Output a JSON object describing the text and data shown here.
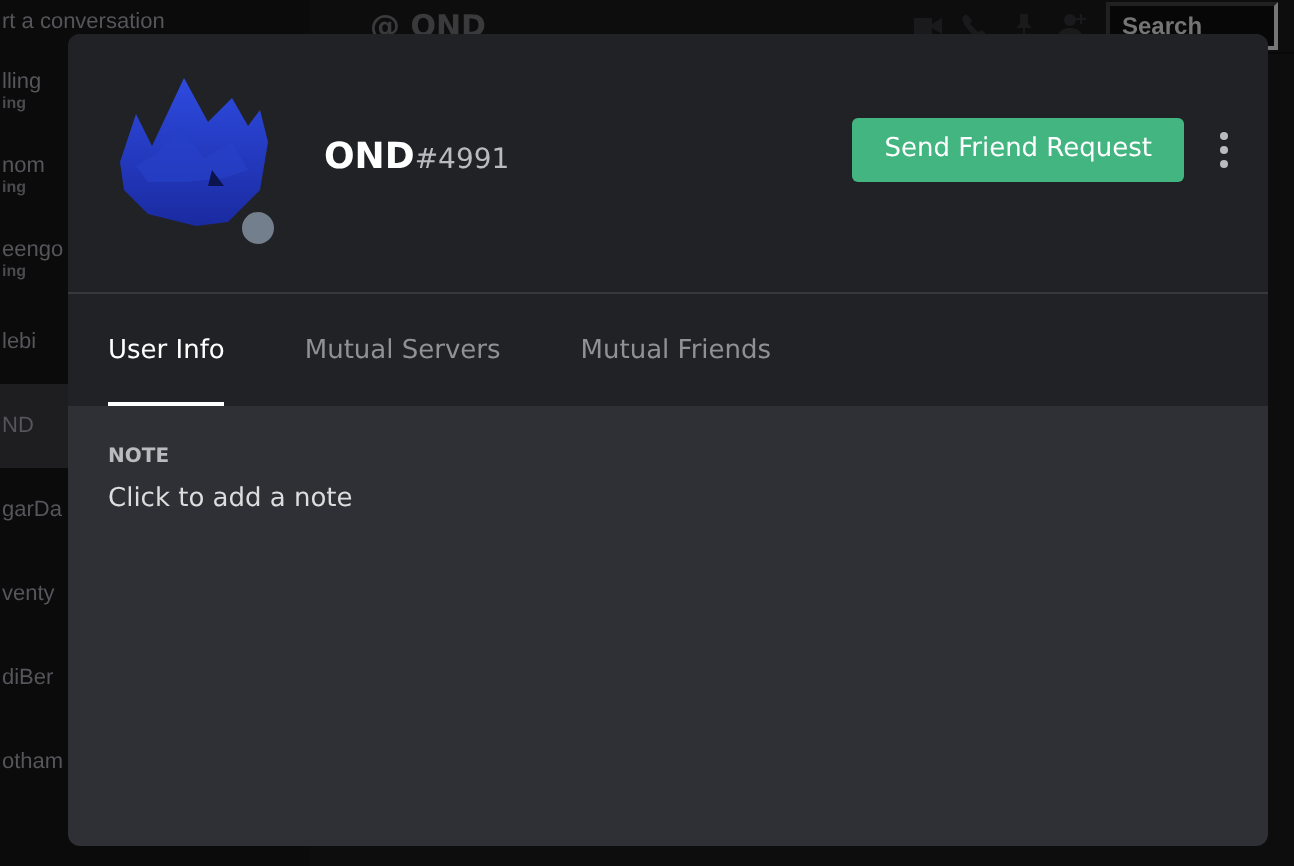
{
  "background": {
    "sidebar": {
      "items": [
        {
          "name": "rt a conversation",
          "selected": false
        },
        {
          "name": "lling",
          "subtitle": "ing",
          "selected": false
        },
        {
          "name": "nom",
          "subtitle": "ing",
          "selected": false
        },
        {
          "name": "eengo",
          "subtitle": "ing",
          "selected": false
        },
        {
          "name": "lebi",
          "selected": false
        },
        {
          "name": "ND",
          "selected": true
        },
        {
          "name": "garDa",
          "selected": false
        },
        {
          "name": "venty",
          "selected": false
        },
        {
          "name": "diBer",
          "selected": false
        },
        {
          "name": "otham",
          "selected": false
        }
      ]
    },
    "header": {
      "channel": "@ OND",
      "search_placeholder": "Search"
    }
  },
  "profile": {
    "username": "OND",
    "discriminator": "#4991",
    "action_button": "Send Friend Request",
    "tabs": [
      {
        "label": "User Info",
        "selected": true
      },
      {
        "label": "Mutual Servers",
        "selected": false
      },
      {
        "label": "Mutual Friends",
        "selected": false
      }
    ],
    "note": {
      "label": "NOTE",
      "placeholder": "Click to add a note"
    }
  }
}
